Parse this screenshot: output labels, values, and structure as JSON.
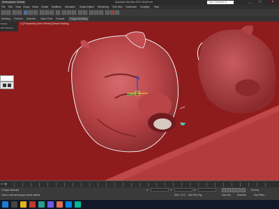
{
  "window": {
    "title": "Autodesk 3ds Max 2017    NewFrom.",
    "workspace": "Workspaces: Default",
    "search_placeholder": "Type a keyword or phrase",
    "controls": [
      "_",
      "□",
      "×"
    ]
  },
  "menu": [
    "File",
    "Edit",
    "Tools",
    "Group",
    "Views",
    "Create",
    "Modifiers",
    "Animation",
    "Graph Editors",
    "Rendering",
    "Civil View",
    "Customize",
    "Scripting",
    "Help"
  ],
  "ribbon": {
    "tabs": [
      "Modeling",
      "Freeform",
      "Selection",
      "Object Paint",
      "Populate"
    ],
    "active_tab": "Polygon Modeling"
  },
  "left_strip": {
    "line1": "Display",
    "line2": "Edit Selected"
  },
  "viewport": {
    "label": "[+] [Perspective] [User Defined] [Default Shading]",
    "object": "bulldog-head",
    "background": "#8e1c1c"
  },
  "status": {
    "frame": "0 / 100",
    "selected": "1 Object Selected",
    "prompt": "Click or click-and-drag to select objects",
    "x_label": "X:",
    "x": "",
    "y_label": "Y:",
    "y": "",
    "z_label": "Z:",
    "z": "",
    "grid": "Grid = 10.0",
    "auto_key": "Auto Key",
    "set_key": "Set Key",
    "selected_dd": "Selected",
    "add_time_tag": "Add Time Tag",
    "key_filters": "Key Filters..."
  },
  "taskbar": {
    "time": "",
    "date": ""
  },
  "colors": {
    "viewport": "#8e1c1c",
    "model": "#c0494d",
    "accent": "#3b6fb0"
  }
}
